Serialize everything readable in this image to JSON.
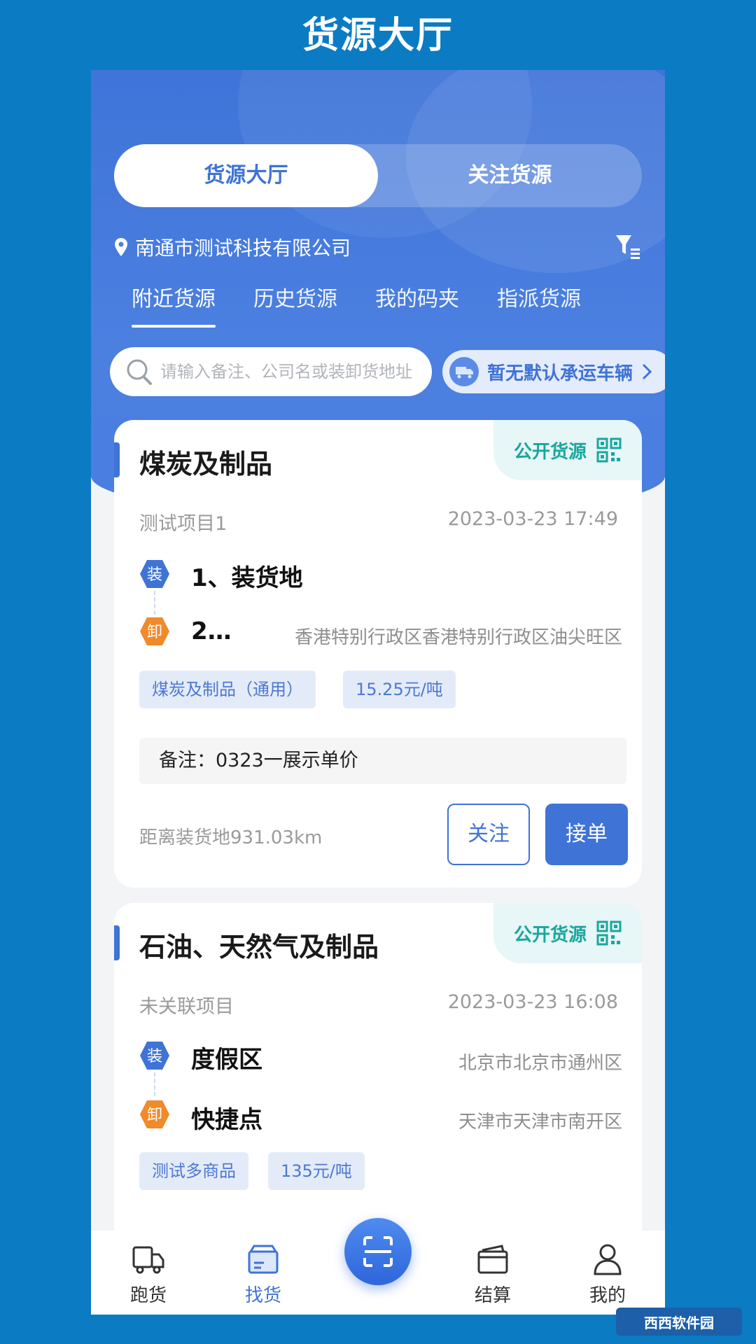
{
  "banner": {
    "title": "货源大厅"
  },
  "segment": {
    "tabs": [
      {
        "label": "货源大厅"
      },
      {
        "label": "关注货源"
      }
    ]
  },
  "company": {
    "name": "南通市测试科技有限公司"
  },
  "subtabs": [
    {
      "label": "附近货源"
    },
    {
      "label": "历史货源"
    },
    {
      "label": "我的码夹"
    },
    {
      "label": "指派货源"
    }
  ],
  "search": {
    "placeholder": "请输入备注、公司名或装卸货地址"
  },
  "vehicle": {
    "label": "暂无默认承运车辆"
  },
  "cards": [
    {
      "title": "煤炭及制品",
      "badge": "公开货源",
      "project": "测试项目1",
      "time": "2023-03-23 17:49",
      "load_icon": "装",
      "unload_icon": "卸",
      "load_name": "1、装货地",
      "load_addr": "",
      "unload_name": "2…",
      "unload_addr": "香港特别行政区香港特别行政区油尖旺区",
      "tags": [
        "煤炭及制品（通用）",
        "15.25元/吨"
      ],
      "remark": "备注：0323一展示单价",
      "distance": "距离装货地931.03km",
      "follow_label": "关注",
      "accept_label": "接单"
    },
    {
      "title": "石油、天然气及制品",
      "badge": "公开货源",
      "project": "未关联项目",
      "time": "2023-03-23 16:08",
      "load_icon": "装",
      "unload_icon": "卸",
      "load_name": "度假区",
      "load_addr": "北京市北京市通州区",
      "unload_name": "快捷点",
      "unload_addr": "天津市天津市南开区",
      "tags": [
        "测试多商品",
        "135元/吨"
      ]
    }
  ],
  "nav": [
    {
      "label": "跑货"
    },
    {
      "label": "找货"
    },
    {
      "label": "结算"
    },
    {
      "label": "我的"
    }
  ],
  "watermark": "西西软件园",
  "colors": {
    "primary": "#3f73d6",
    "teal": "#1aa69e",
    "orange": "#f08a2a",
    "page_bg": "#0b7bc4"
  }
}
